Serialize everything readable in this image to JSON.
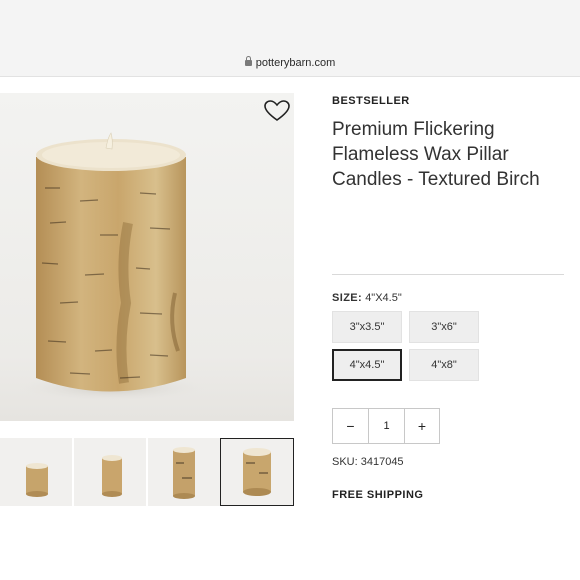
{
  "browser": {
    "domain": "potterybarn.com",
    "lock_icon": "lock-icon"
  },
  "gallery": {
    "main_image": "birch-pillar-candle-image",
    "favorite_icon": "heart-icon",
    "thumbnails": [
      {
        "name": "thumbnail-1",
        "selected": false
      },
      {
        "name": "thumbnail-2",
        "selected": false
      },
      {
        "name": "thumbnail-3",
        "selected": false
      },
      {
        "name": "thumbnail-4",
        "selected": true
      }
    ]
  },
  "product": {
    "badge": "BESTSELLER",
    "title": "Premium Flickering Flameless Wax Pillar Candles - Textured Birch",
    "size_label": "SIZE:",
    "size_value": "4\"X4.5\"",
    "sizes": [
      {
        "label": "3\"x3.5\"",
        "selected": false
      },
      {
        "label": "3\"x6\"",
        "selected": false
      },
      {
        "label": "4\"x4.5\"",
        "selected": true
      },
      {
        "label": "4\"x8\"",
        "selected": false
      }
    ],
    "quantity": {
      "minus": "−",
      "value": "1",
      "plus": "+"
    },
    "sku": "SKU: 3417045",
    "shipping": "FREE SHIPPING"
  },
  "colors": {
    "selected_border": "#222222",
    "button_bg": "#eeeeee",
    "birch_bark": "#c8a872"
  }
}
